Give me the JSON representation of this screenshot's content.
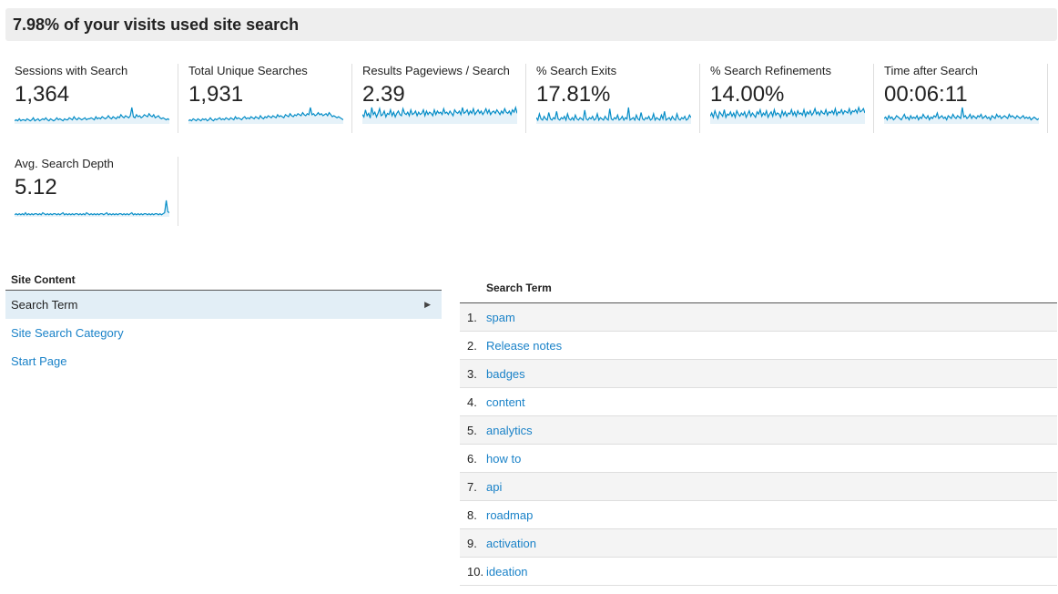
{
  "header": {
    "title": "7.98% of your visits used site search"
  },
  "metrics": [
    {
      "label": "Sessions with Search",
      "value": "1,364",
      "spark": [
        3,
        4,
        3,
        5,
        3,
        4,
        4,
        3,
        5,
        4,
        3,
        4,
        6,
        3,
        4,
        5,
        3,
        4,
        5,
        4,
        6,
        4,
        3,
        5,
        4,
        3,
        4,
        6,
        4,
        5,
        4,
        3,
        5,
        4,
        4,
        6,
        5,
        4,
        7,
        5,
        4,
        6,
        5,
        4,
        5,
        6,
        4,
        5,
        5,
        6,
        5,
        4,
        7,
        5,
        6,
        5,
        7,
        6,
        5,
        6,
        8,
        6,
        5,
        7,
        6,
        5,
        7,
        6,
        9,
        7,
        6,
        8,
        7,
        6,
        8,
        16,
        7,
        6,
        9,
        7,
        8,
        6,
        7,
        9,
        8,
        7,
        10,
        8,
        7,
        9,
        6,
        7,
        8,
        6,
        5,
        6,
        5,
        4,
        5,
        4
      ]
    },
    {
      "label": "Total Unique Searches",
      "value": "1,931",
      "spark": [
        3,
        4,
        3,
        5,
        4,
        3,
        5,
        4,
        3,
        5,
        4,
        5,
        3,
        4,
        6,
        4,
        3,
        5,
        4,
        5,
        6,
        4,
        5,
        4,
        6,
        5,
        4,
        6,
        5,
        4,
        7,
        5,
        6,
        5,
        4,
        6,
        7,
        5,
        6,
        5,
        7,
        6,
        5,
        7,
        6,
        5,
        8,
        6,
        5,
        7,
        6,
        8,
        7,
        6,
        8,
        7,
        6,
        9,
        7,
        8,
        7,
        6,
        9,
        8,
        7,
        10,
        8,
        7,
        9,
        8,
        10,
        9,
        8,
        11,
        9,
        8,
        10,
        9,
        16,
        9,
        10,
        8,
        9,
        11,
        9,
        10,
        8,
        9,
        10,
        8,
        11,
        9,
        7,
        8,
        7,
        6,
        7,
        6,
        5,
        4
      ]
    },
    {
      "label": "Results Pageviews / Search",
      "value": "2.39",
      "spark": [
        8,
        6,
        12,
        7,
        9,
        5,
        14,
        8,
        10,
        6,
        9,
        13,
        7,
        8,
        11,
        6,
        9,
        8,
        12,
        7,
        10,
        6,
        9,
        11,
        8,
        7,
        13,
        9,
        8,
        10,
        7,
        12,
        8,
        9,
        11,
        7,
        10,
        8,
        9,
        12,
        7,
        11,
        8,
        10,
        9,
        7,
        12,
        8,
        11,
        9,
        10,
        8,
        13,
        9,
        10,
        8,
        11,
        9,
        7,
        12,
        10,
        9,
        11,
        8,
        14,
        9,
        10,
        12,
        8,
        11,
        9,
        13,
        8,
        10,
        12,
        9,
        11,
        8,
        10,
        13,
        9,
        12,
        8,
        10,
        11,
        9,
        12,
        10,
        8,
        11,
        9,
        13,
        10,
        9,
        11,
        8,
        12,
        10,
        14,
        9
      ]
    },
    {
      "label": "% Search Exits",
      "value": "17.81%",
      "spark": [
        5,
        3,
        8,
        4,
        3,
        6,
        4,
        3,
        9,
        4,
        3,
        5,
        4,
        10,
        4,
        3,
        5,
        4,
        6,
        3,
        8,
        4,
        3,
        5,
        3,
        7,
        4,
        3,
        5,
        4,
        3,
        11,
        4,
        3,
        5,
        4,
        6,
        3,
        4,
        8,
        3,
        5,
        4,
        3,
        6,
        4,
        3,
        12,
        4,
        3,
        5,
        4,
        7,
        3,
        4,
        6,
        3,
        5,
        4,
        13,
        3,
        4,
        5,
        3,
        7,
        4,
        3,
        9,
        4,
        3,
        5,
        4,
        6,
        3,
        4,
        8,
        3,
        5,
        4,
        3,
        7,
        4,
        10,
        3,
        4,
        5,
        3,
        6,
        4,
        3,
        8,
        4,
        3,
        5,
        4,
        6,
        3,
        4,
        7,
        5
      ]
    },
    {
      "label": "% Search Refinements",
      "value": "14.00%",
      "spark": [
        7,
        10,
        6,
        12,
        8,
        5,
        11,
        9,
        7,
        13,
        6,
        9,
        8,
        11,
        7,
        10,
        6,
        12,
        9,
        7,
        10,
        8,
        11,
        6,
        9,
        12,
        7,
        10,
        8,
        6,
        11,
        9,
        13,
        7,
        10,
        8,
        12,
        6,
        9,
        11,
        7,
        13,
        8,
        10,
        9,
        6,
        12,
        8,
        11,
        7,
        10,
        9,
        13,
        8,
        11,
        7,
        12,
        9,
        10,
        8,
        13,
        7,
        11,
        9,
        12,
        8,
        10,
        14,
        9,
        11,
        8,
        12,
        10,
        9,
        13,
        8,
        11,
        10,
        12,
        9,
        14,
        8,
        11,
        10,
        13,
        9,
        12,
        11,
        10,
        14,
        9,
        12,
        11,
        13,
        10,
        15,
        11,
        12,
        14,
        10
      ]
    },
    {
      "label": "Time after Search",
      "value": "00:06:11",
      "spark": [
        4,
        5,
        3,
        6,
        4,
        5,
        3,
        4,
        6,
        5,
        4,
        3,
        5,
        7,
        4,
        5,
        3,
        6,
        4,
        5,
        4,
        6,
        3,
        5,
        4,
        7,
        5,
        4,
        6,
        3,
        5,
        4,
        6,
        5,
        8,
        4,
        5,
        6,
        4,
        5,
        3,
        6,
        5,
        4,
        7,
        5,
        4,
        6,
        5,
        4,
        12,
        5,
        6,
        4,
        5,
        7,
        4,
        6,
        5,
        4,
        6,
        5,
        7,
        4,
        5,
        6,
        4,
        5,
        3,
        6,
        5,
        4,
        7,
        5,
        6,
        4,
        5,
        6,
        5,
        4,
        7,
        5,
        6,
        5,
        4,
        6,
        5,
        4,
        5,
        6,
        4,
        5,
        4,
        5,
        3,
        4,
        5,
        4,
        3,
        4
      ]
    },
    {
      "label": "Avg. Search Depth",
      "value": "5.12",
      "spark": [
        2,
        3,
        2,
        3,
        2,
        3,
        2,
        4,
        2,
        3,
        2,
        3,
        2,
        3,
        3,
        2,
        3,
        2,
        4,
        3,
        2,
        3,
        2,
        3,
        2,
        3,
        3,
        2,
        3,
        2,
        3,
        4,
        2,
        3,
        2,
        3,
        2,
        3,
        2,
        3,
        3,
        2,
        3,
        2,
        3,
        2,
        4,
        3,
        2,
        3,
        2,
        3,
        2,
        3,
        2,
        3,
        3,
        2,
        3,
        4,
        2,
        3,
        2,
        3,
        2,
        3,
        2,
        3,
        3,
        2,
        3,
        2,
        3,
        2,
        3,
        4,
        2,
        3,
        2,
        3,
        2,
        3,
        2,
        3,
        3,
        2,
        3,
        2,
        3,
        2,
        3,
        3,
        2,
        3,
        2,
        3,
        4,
        16,
        5,
        4
      ]
    }
  ],
  "colors": {
    "accent": "#058dc7",
    "link": "#1a82c8",
    "selected_bg": "#e2eef6"
  },
  "site_content": {
    "title": "Site Content",
    "items": [
      {
        "label": "Search Term",
        "selected": true
      },
      {
        "label": "Site Search Category",
        "selected": false
      },
      {
        "label": "Start Page",
        "selected": false
      }
    ],
    "chevron_icon": "chevron-right-icon"
  },
  "table": {
    "header": "Search Term",
    "rows": [
      {
        "num": "1.",
        "term": "spam"
      },
      {
        "num": "2.",
        "term": "Release notes"
      },
      {
        "num": "3.",
        "term": "badges"
      },
      {
        "num": "4.",
        "term": "content"
      },
      {
        "num": "5.",
        "term": "analytics"
      },
      {
        "num": "6.",
        "term": "how to"
      },
      {
        "num": "7.",
        "term": "api"
      },
      {
        "num": "8.",
        "term": "roadmap"
      },
      {
        "num": "9.",
        "term": "activation"
      },
      {
        "num": "10.",
        "term": "ideation"
      }
    ]
  }
}
